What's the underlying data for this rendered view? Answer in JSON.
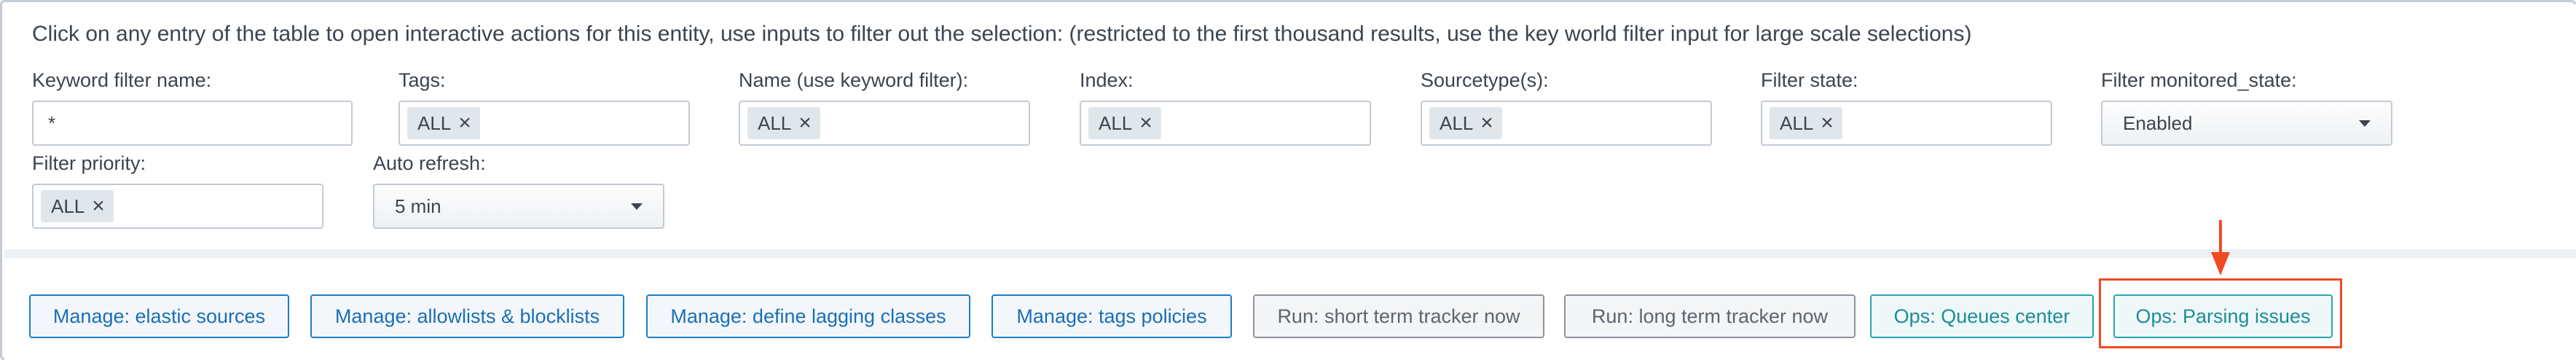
{
  "instruction": "Click on any entry of the table to open interactive actions for this entity, use inputs to filter out the selection: (restricted to the first thousand results, use the key world filter input for large scale selections)",
  "filters": {
    "keyword": {
      "label": "Keyword filter name:",
      "value": "*"
    },
    "tags": {
      "label": "Tags:",
      "token": "ALL"
    },
    "name": {
      "label": "Name (use keyword filter):",
      "token": "ALL"
    },
    "index": {
      "label": "Index:",
      "token": "ALL"
    },
    "sourcetype": {
      "label": "Sourcetype(s):",
      "token": "ALL"
    },
    "state": {
      "label": "Filter state:",
      "token": "ALL"
    },
    "monitored_state": {
      "label": "Filter monitored_state:",
      "value": "Enabled"
    },
    "priority": {
      "label": "Filter priority:",
      "token": "ALL"
    },
    "auto_refresh": {
      "label": "Auto refresh:",
      "value": "5 min"
    }
  },
  "actions": [
    {
      "label": "Manage: elastic sources",
      "style": "blue"
    },
    {
      "label": "Manage: allowlists & blocklists",
      "style": "blue"
    },
    {
      "label": "Manage: define lagging classes",
      "style": "blue"
    },
    {
      "label": "Manage: tags policies",
      "style": "blue"
    },
    {
      "label": "Run: short term tracker now",
      "style": "grey"
    },
    {
      "label": "Run: long term tracker now",
      "style": "grey"
    },
    {
      "label": "Ops: Queues center",
      "style": "teal"
    },
    {
      "label": "Ops: Parsing issues",
      "style": "teal"
    }
  ],
  "remove_glyph": "×",
  "colors": {
    "manage_button": "#1a7fc4",
    "run_button": "#8d949b",
    "ops_button": "#29a3b0",
    "highlight": "#f04a23"
  },
  "icons": {
    "token_remove": "close-icon",
    "dropdown": "caret-down-icon",
    "annotation": "arrow-down-icon"
  }
}
